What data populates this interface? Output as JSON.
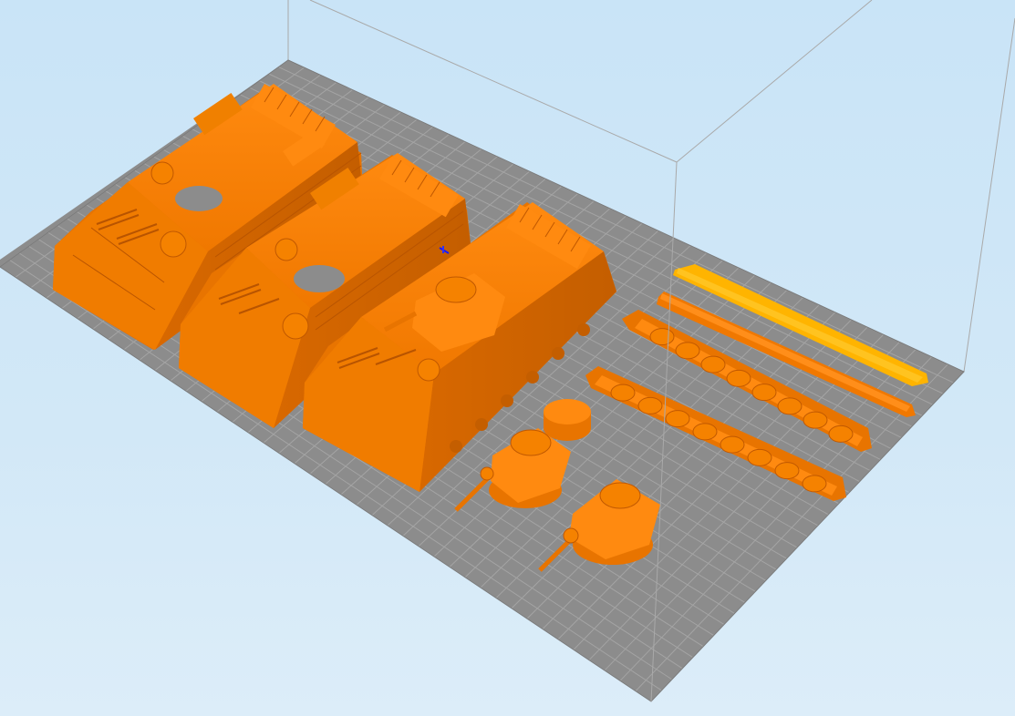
{
  "viewport": {
    "background": "#cfe6f7",
    "bed_color": "#8c8c8c",
    "bed_grid_color": "#a2a2a2",
    "build_volume_line_color": "#a9a9a9"
  },
  "objects": [
    {
      "id": "hull-1",
      "kind": "vehicle-hull",
      "color": "#ff8000",
      "selected": false
    },
    {
      "id": "hull-2",
      "kind": "vehicle-hull",
      "color": "#ff8000",
      "selected": false
    },
    {
      "id": "hull-3",
      "kind": "vehicle-hull-with-turret",
      "color": "#ff8000",
      "selected": false
    },
    {
      "id": "turret-1",
      "kind": "turret",
      "color": "#ff8000",
      "selected": false
    },
    {
      "id": "turret-2",
      "kind": "turret",
      "color": "#ff8000",
      "selected": false
    },
    {
      "id": "hatch-1",
      "kind": "round-hatch",
      "color": "#ff8000",
      "selected": false
    },
    {
      "id": "track-1",
      "kind": "track",
      "color": "#ff8000",
      "selected": false
    },
    {
      "id": "track-2",
      "kind": "track",
      "color": "#ff8000",
      "selected": false
    },
    {
      "id": "strip-1",
      "kind": "side-skirt",
      "color": "#ff8000",
      "selected": false
    },
    {
      "id": "strip-2",
      "kind": "side-skirt",
      "color": "#ffaa00",
      "selected": true
    }
  ],
  "icons": {
    "origin_marker": "axis-origin-icon"
  }
}
